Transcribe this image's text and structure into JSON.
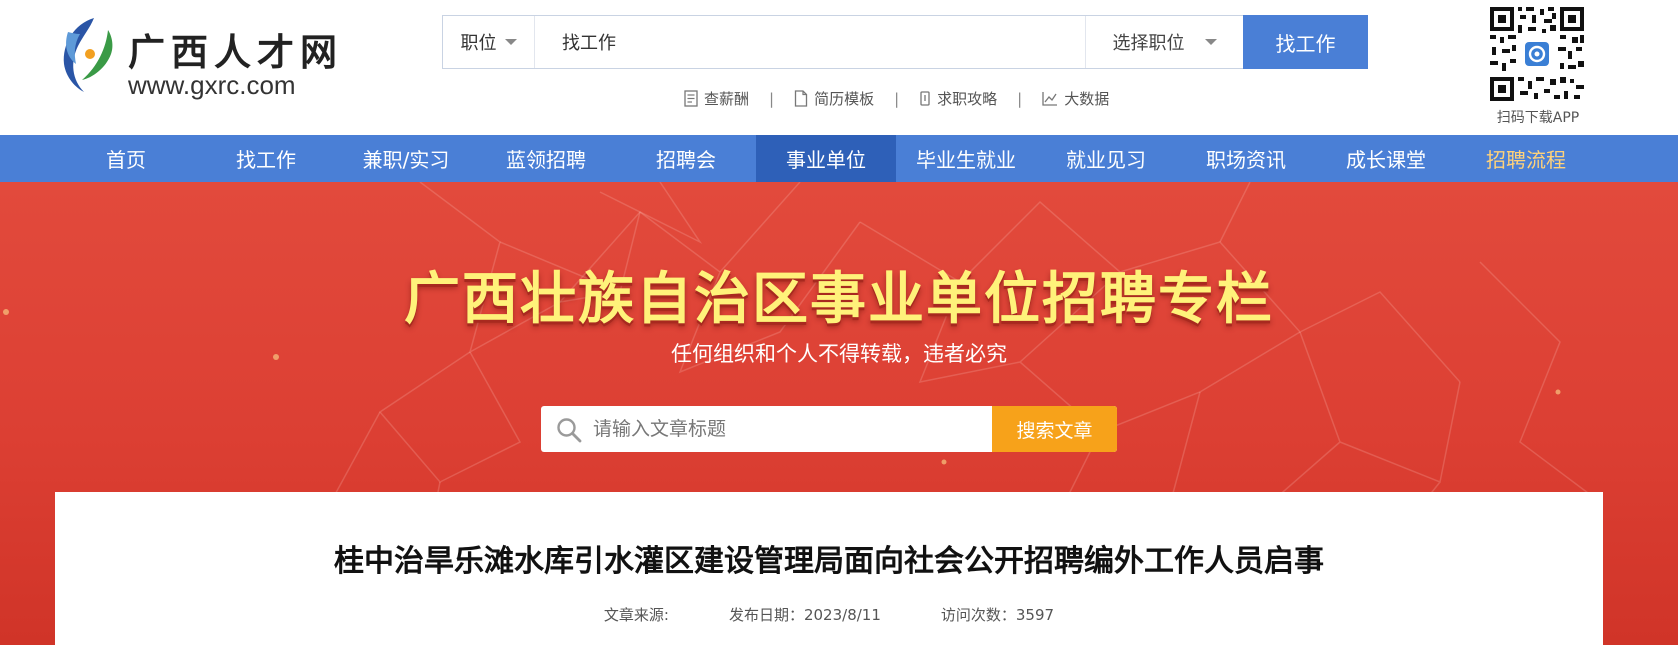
{
  "header": {
    "logo": {
      "name_cn": "广西人才网",
      "url": "www.gxrc.com"
    },
    "search": {
      "type_label": "职位",
      "input_value": "找工作",
      "position_select_label": "选择职位",
      "button_label": "找工作"
    },
    "quick_links": [
      {
        "label": "查薪酬",
        "icon": "document-icon"
      },
      {
        "label": "简历模板",
        "icon": "file-icon"
      },
      {
        "label": "求职攻略",
        "icon": "pen-icon"
      },
      {
        "label": "大数据",
        "icon": "line-chart-icon"
      }
    ],
    "quick_link_separator": "|",
    "qr": {
      "caption": "扫码下载APP"
    }
  },
  "nav": {
    "items": [
      {
        "label": "首页"
      },
      {
        "label": "找工作"
      },
      {
        "label": "兼职/实习"
      },
      {
        "label": "蓝领招聘"
      },
      {
        "label": "招聘会"
      },
      {
        "label": "事业单位",
        "state": "active"
      },
      {
        "label": "毕业生就业"
      },
      {
        "label": "就业见习"
      },
      {
        "label": "职场资讯"
      },
      {
        "label": "成长课堂"
      },
      {
        "label": "招聘流程",
        "state": "highlight"
      }
    ]
  },
  "banner": {
    "title": "广西壮族自治区事业单位招聘专栏",
    "subtitle": "任何组织和个人不得转载，违者必究",
    "search": {
      "placeholder": "请输入文章标题",
      "button_label": "搜索文章"
    }
  },
  "article": {
    "title": "桂中治旱乐滩水库引水灌区建设管理局面向社会公开招聘编外工作人员启事",
    "meta": {
      "source": "文章来源:",
      "publish_date": "发布日期：2023/8/11",
      "views": "访问次数：3597"
    }
  },
  "colors": {
    "primary_blue": "#4a7fd6",
    "nav_active": "#2e60b8",
    "nav_highlight_text": "#ffd27a",
    "banner_red": "#dc3f33",
    "banner_title_yellow": "#fff27a",
    "search_button_orange": "#f7a21a"
  }
}
